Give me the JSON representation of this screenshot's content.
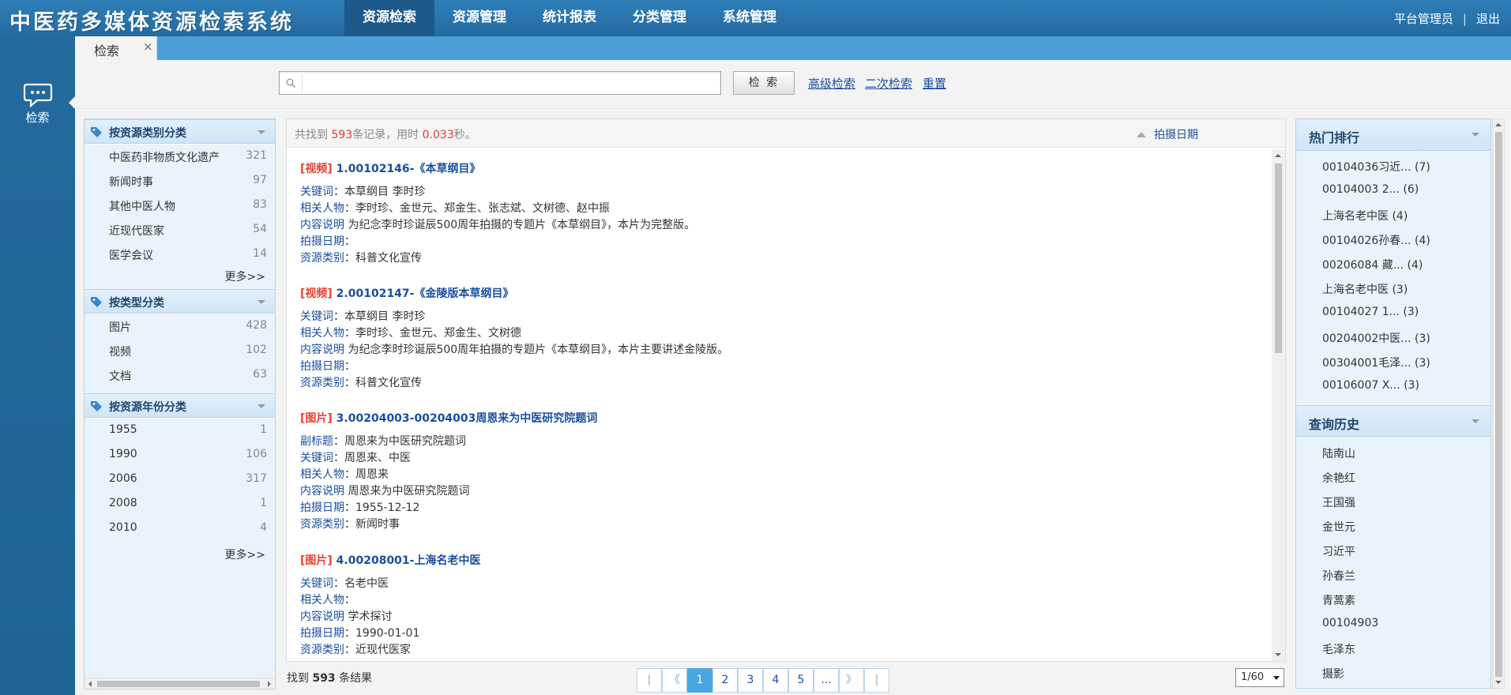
{
  "app": {
    "title": "中医药多媒体资源检索系统"
  },
  "nav": [
    {
      "label": "资源检索",
      "active": true
    },
    {
      "label": "资源管理"
    },
    {
      "label": "统计报表"
    },
    {
      "label": "分类管理"
    },
    {
      "label": "系统管理"
    }
  ],
  "user": {
    "name": "平台管理员",
    "separator": "|",
    "logout": "退出"
  },
  "rail": {
    "search_label": "检索",
    "icon": "chat-bubble-icon"
  },
  "tabs": [
    {
      "label": "检索",
      "close": "×"
    }
  ],
  "search": {
    "value": "",
    "placeholder": "",
    "button": "检 索",
    "advanced": "高级检索",
    "secondary": "二次检索",
    "reset": "重置"
  },
  "facets": {
    "resource_type": {
      "title": "按资源类别分类",
      "items": [
        {
          "name": "中医药非物质文化遗产",
          "count": "321"
        },
        {
          "name": "新闻时事",
          "count": "97"
        },
        {
          "name": "其他中医人物",
          "count": "83"
        },
        {
          "name": "近现代医家",
          "count": "54"
        },
        {
          "name": "医学会议",
          "count": "14"
        }
      ],
      "more": "更多>>"
    },
    "media_type": {
      "title": "按类型分类",
      "items": [
        {
          "name": "图片",
          "count": "428"
        },
        {
          "name": "视频",
          "count": "102"
        },
        {
          "name": "文档",
          "count": "63"
        }
      ]
    },
    "year": {
      "title": "按资源年份分类",
      "items": [
        {
          "name": "1955",
          "count": "1"
        },
        {
          "name": "1990",
          "count": "106"
        },
        {
          "name": "2006",
          "count": "317"
        },
        {
          "name": "2008",
          "count": "1"
        },
        {
          "name": "2010",
          "count": "4"
        }
      ],
      "more": "更多>>"
    }
  },
  "results": {
    "summary_prefix": "共找到 ",
    "total": "593",
    "summary_mid": "条记录，用时 ",
    "time": "0.033",
    "summary_suffix": "秒。",
    "sort_label": "拍摄日期",
    "items": [
      {
        "type": "[视频]",
        "title": "1.00102146-《本草纲目》",
        "fields": [
          {
            "k": "关键词",
            "sep": "：",
            "v": "本草纲目 李时珍"
          },
          {
            "k": "相关人物",
            "sep": "：",
            "v": "李时珍、金世元、郑金生、张志斌、文树德、赵中振"
          },
          {
            "k": "内容说明",
            "sep": " ",
            "v": "为纪念李时珍诞辰500周年拍摄的专题片《本草纲目》，本片为完整版。"
          },
          {
            "k": "拍摄日期",
            "sep": "：",
            "v": ""
          },
          {
            "k": "资源类别",
            "sep": "：",
            "v": "科普文化宣传"
          }
        ]
      },
      {
        "type": "[视频]",
        "title": "2.00102147-《金陵版本草纲目》",
        "fields": [
          {
            "k": "关键词",
            "sep": "：",
            "v": "本草纲目 李时珍"
          },
          {
            "k": "相关人物",
            "sep": "：",
            "v": "李时珍、金世元、郑金生、文树德"
          },
          {
            "k": "内容说明",
            "sep": " ",
            "v": "为纪念李时珍诞辰500周年拍摄的专题片《本草纲目》，本片主要讲述金陵版。"
          },
          {
            "k": "拍摄日期",
            "sep": "：",
            "v": ""
          },
          {
            "k": "资源类别",
            "sep": "：",
            "v": "科普文化宣传"
          }
        ]
      },
      {
        "type": "[图片]",
        "title": "3.00204003-00204003周恩来为中医研究院题词",
        "fields": [
          {
            "k": "副标题",
            "sep": "：",
            "v": "周恩来为中医研究院题词"
          },
          {
            "k": "关键词",
            "sep": "：",
            "v": "周恩来、中医"
          },
          {
            "k": "相关人物",
            "sep": "：",
            "v": "周恩来"
          },
          {
            "k": "内容说明",
            "sep": " ",
            "v": "周恩来为中医研究院题词"
          },
          {
            "k": "拍摄日期",
            "sep": "：",
            "v": "1955-12-12"
          },
          {
            "k": "资源类别",
            "sep": "：",
            "v": "新闻时事"
          }
        ]
      },
      {
        "type": "[图片]",
        "title": "4.00208001-上海名老中医",
        "fields": [
          {
            "k": "关键词",
            "sep": "：",
            "v": "名老中医"
          },
          {
            "k": "相关人物",
            "sep": "：",
            "v": ""
          },
          {
            "k": "内容说明",
            "sep": " ",
            "v": "学术探讨"
          },
          {
            "k": "拍摄日期",
            "sep": "：",
            "v": "1990-01-01"
          },
          {
            "k": "资源类别",
            "sep": "：",
            "v": "近现代医家"
          }
        ]
      }
    ]
  },
  "footer": {
    "found_prefix": "找到 ",
    "found_count": "593",
    "found_suffix": " 条结果",
    "pages": [
      "1",
      "2",
      "3",
      "4",
      "5",
      "..."
    ],
    "first": "|",
    "prev": "《",
    "next": "》",
    "last": "|",
    "current": "1/60"
  },
  "hot": {
    "title": "热门排行",
    "items": [
      "00104036习近... (7)",
      "00104003 2... (6)",
      "上海名老中医 (4)",
      "00104026孙春... (4)",
      "00206084 藏... (4)",
      "上海名老中医 (3)",
      "00104027 1... (3)",
      "00204002中医... (3)",
      "00304001毛泽... (3)",
      "00106007 X... (3)"
    ]
  },
  "history": {
    "title": "查询历史",
    "items": [
      "陆南山",
      "余艳红",
      "王国强",
      "金世元",
      "习近平",
      "孙春兰",
      "青蒿素",
      "00104903",
      "毛泽东",
      "摄影"
    ]
  },
  "colors": {
    "header": "#2f7fb8",
    "accent": "#4aa6e0",
    "link": "#1a4fa0",
    "type_tag": "#e8412f"
  }
}
